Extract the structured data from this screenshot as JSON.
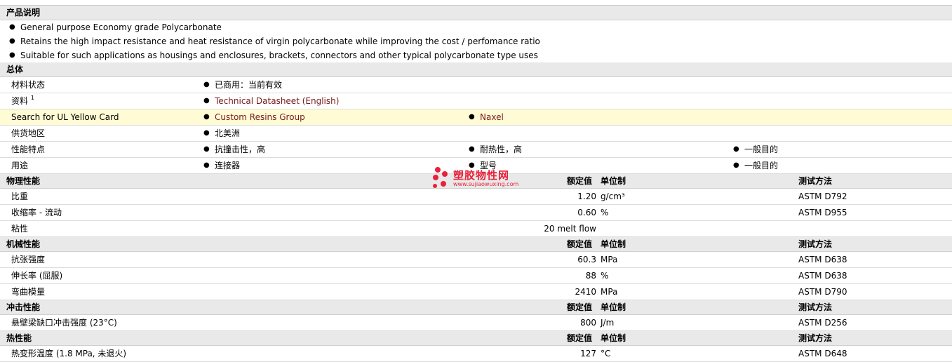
{
  "description": {
    "title": "产品说明",
    "items": [
      "General purpose Economy grade Polycarbonate",
      "Retains the high impact resistance and heat resistance of virgin polycarbonate while improving the cost / perfomance ratio",
      "Suitable for such applications as housings and enclosures, brackets, connectors and other typical polycarbonate type uses"
    ]
  },
  "general": {
    "title": "总体",
    "rows": {
      "status": {
        "label": "材料状态",
        "value": "已商用：当前有效"
      },
      "docs": {
        "label": "资料",
        "sup": "1",
        "link": "Technical Datasheet (English)"
      },
      "ul": {
        "label": "Search for UL Yellow Card",
        "link1": "Custom Resins Group",
        "link2": "Naxel"
      },
      "region": {
        "label": "供货地区",
        "value": "北美洲"
      },
      "features": {
        "label": "性能特点",
        "v1": "抗撞击性，高",
        "v2": "耐热性，高",
        "v3": "一般目的"
      },
      "uses": {
        "label": "用途",
        "v1": "连接器",
        "v2": "型号",
        "v3": "一般目的"
      }
    }
  },
  "columns": {
    "nominal": "额定值",
    "unit": "单位制",
    "method": "测试方法"
  },
  "physical": {
    "title": "物理性能",
    "rows": [
      {
        "label": "比重",
        "value": "1.20",
        "unit": "g/cm³",
        "method": "ASTM D792"
      },
      {
        "label": "收缩率  - 流动",
        "value": "0.60",
        "unit": "%",
        "method": "ASTM D955"
      },
      {
        "label": "粘性",
        "value": "20 melt flow",
        "unit": "",
        "method": ""
      }
    ]
  },
  "mechanical": {
    "title": "机械性能",
    "rows": [
      {
        "label": "抗张强度",
        "value": "60.3",
        "unit": "MPa",
        "method": "ASTM D638"
      },
      {
        "label": "伸长率  (屈服)",
        "value": "88",
        "unit": "%",
        "method": "ASTM D638"
      },
      {
        "label": "弯曲模量",
        "value": "2410",
        "unit": "MPa",
        "method": "ASTM D790"
      }
    ]
  },
  "impact": {
    "title": "冲击性能",
    "rows": [
      {
        "label": "悬壁梁缺口冲击强度  (23°C)",
        "value": "800",
        "unit": "J/m",
        "method": "ASTM D256"
      }
    ]
  },
  "thermal": {
    "title": "热性能",
    "rows": [
      {
        "label": "热变形温度  (1.8 MPa, 未退火)",
        "value": "127",
        "unit": "°C",
        "method": "ASTM D648"
      }
    ]
  },
  "watermark": {
    "name": "塑胶物性网",
    "url": "www.sujiaowuxing.com"
  },
  "colors": {
    "link": "#7a1a1a",
    "header_bg": "#e9e9e9",
    "highlight": "#fffbd4",
    "watermark": "#e8213a"
  }
}
